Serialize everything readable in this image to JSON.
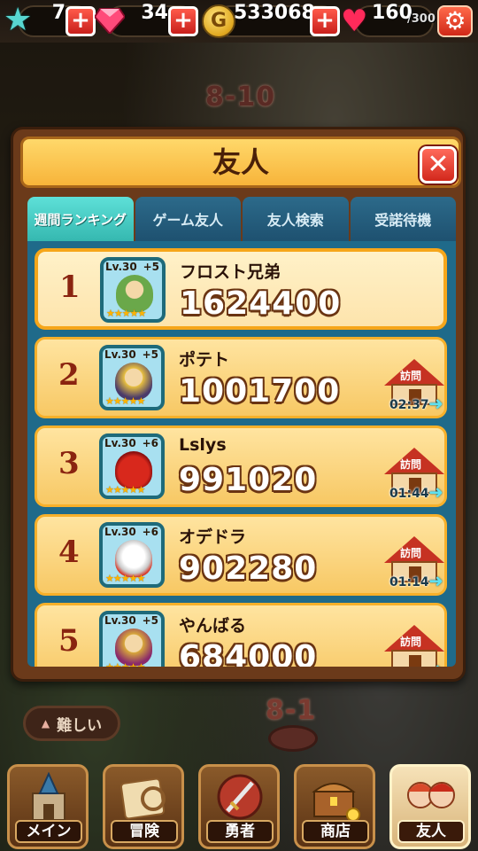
{
  "header": {
    "stars": "7",
    "gems": "34",
    "gold": "533068",
    "stamina": "160",
    "stamina_max": "/300",
    "coin_symbol": "G",
    "plus_symbol": "+"
  },
  "map": {
    "stage_top": "8-10",
    "stage_bottom": "8-1",
    "difficulty_label": "難しい"
  },
  "dialog": {
    "title": "友人",
    "close_symbol": "✕",
    "tabs": [
      {
        "label": "週間ランキング",
        "active": true
      },
      {
        "label": "ゲーム友人",
        "active": false
      },
      {
        "label": "友人検索",
        "active": false
      },
      {
        "label": "受諾待機",
        "active": false
      }
    ]
  },
  "ranking": [
    {
      "rank": "1",
      "level": "Lv.30",
      "plus": "+5",
      "stars": "★★★★★",
      "name": "フロスト兄弟",
      "score": "1624400",
      "self": true,
      "char_color": "#6aa84a"
    },
    {
      "rank": "2",
      "level": "Lv.30",
      "plus": "+5",
      "stars": "★★★★★",
      "name": "ポテト",
      "score": "1001700",
      "visit_label": "訪問",
      "timer": "02:37",
      "char_color": "#4a3a6a"
    },
    {
      "rank": "3",
      "level": "Lv.30",
      "plus": "+6",
      "stars": "★★★★★",
      "name": "Lslys",
      "score": "991020",
      "visit_label": "訪問",
      "timer": "01:44",
      "char_color": "#d8281c"
    },
    {
      "rank": "4",
      "level": "Lv.30",
      "plus": "+6",
      "stars": "★★★★★",
      "name": "オデドラ",
      "score": "902280",
      "visit_label": "訪問",
      "timer": "01:14",
      "char_color": "#e8e8e8"
    },
    {
      "rank": "5",
      "level": "Lv.30",
      "plus": "+5",
      "stars": "★★★★★",
      "name": "やんばる",
      "score": "684000",
      "visit_label": "訪問",
      "timer": "",
      "char_color": "#d8a83a"
    }
  ],
  "nav": [
    {
      "label": "メイン",
      "icon": "castle-icon",
      "active": false
    },
    {
      "label": "冒険",
      "icon": "map-icon",
      "active": false
    },
    {
      "label": "勇者",
      "icon": "sword-shield-icon",
      "active": false
    },
    {
      "label": "商店",
      "icon": "treasure-chest-icon",
      "active": false
    },
    {
      "label": "友人",
      "icon": "friends-icon",
      "active": true
    }
  ],
  "colors": {
    "accent_teal": "#35b8b0",
    "tab_blue": "#1e5170",
    "row_gold": "#f7c864",
    "rank_red": "#8a2410",
    "dialog_brown": "#6b3a1a"
  }
}
